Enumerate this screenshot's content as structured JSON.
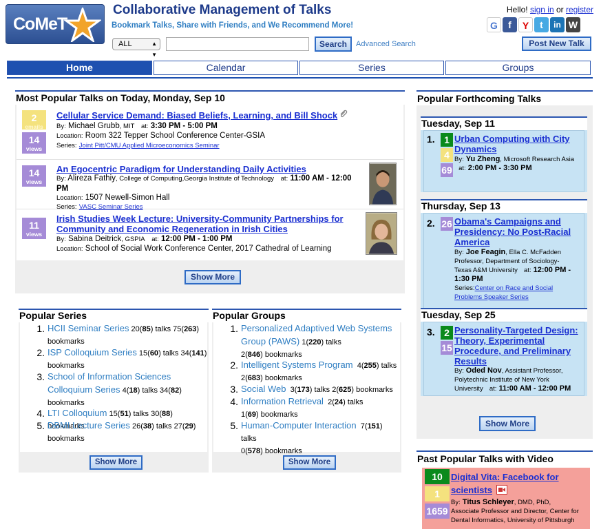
{
  "header": {
    "logo_text": "CoMeT",
    "title": "Collaborative Management of Talks",
    "tagline": "Bookmark Talks, Share with Friends, and We Recommend More!",
    "scope_selected": "ALL",
    "search_value": "",
    "search_button": "Search",
    "advanced_search": "Advanced Search",
    "hello_prefix": "Hello!",
    "sign_in": "sign in",
    "or": "or",
    "register": "register",
    "post_talk": "Post New Talk",
    "social_icons": [
      "google-icon",
      "facebook-icon",
      "yahoo-icon",
      "twitter-icon",
      "linkedin-icon",
      "wordpress-icon"
    ]
  },
  "nav": {
    "tabs": [
      "Home",
      "Calendar",
      "Series",
      "Groups"
    ],
    "active": "Home"
  },
  "popular_today": {
    "heading": "Most Popular Talks on Today, Monday, Sep 10",
    "talks": [
      {
        "title": "Cellular Service Demand: Biased Beliefs, Learning, and Bill Shock",
        "emails": "2",
        "emails_label": "emails",
        "views": "14",
        "views_label": "views",
        "by_label": "By:",
        "speaker": "Michael Grubb",
        "affiliation": ", MIT",
        "at_label": "at:",
        "time": "3:30 PM - 5:00 PM",
        "location_label": "Location:",
        "location": "Room 322 Tepper School Conference Center-GSIA",
        "series_label": "Series:",
        "series": "Joint Pitt/CMU Applied Microeconomics Seminar"
      },
      {
        "title": "An Egocentric Paradigm for Understanding Daily Activities",
        "views": "14",
        "views_label": "views",
        "by_label": "By:",
        "speaker": "Alireza Fathiy",
        "affiliation": ", College of Computing,Georgia Institute of Technology",
        "at_label": "at:",
        "time_a": "11:00 AM -",
        "time_b": "12:00 PM",
        "location_label": "Location:",
        "location": "1507 Newell-Simon Hall",
        "series_label": "Series:",
        "series": "VASC Seminar Series"
      },
      {
        "title_a": "Irish Studies Week Lecture: University-Community Partnerships for",
        "title_b": "Community and Economic Regeneration in Irish Cities",
        "views": "11",
        "views_label": "views",
        "by_label": "By:",
        "speaker": "Sabina Deitrick",
        "affiliation": ", GSPIA",
        "at_label": "at:",
        "time": "12:00 PM - 1:00 PM",
        "location_label": "Location:",
        "location": "School of Social Work Conference Center, 2017 Cathedral of Learning"
      }
    ],
    "show_more": "Show More"
  },
  "popular_series": {
    "heading": "Popular Series",
    "items": [
      {
        "rank": "1.",
        "name": "HCII Seminar Series",
        "a": "20",
        "b": "85",
        "c": "75",
        "d": "263"
      },
      {
        "rank": "2.",
        "name": "ISP Colloquium Series",
        "a": "15",
        "b": "60",
        "c": "34",
        "d": "141"
      },
      {
        "rank": "3.",
        "name_a": "School of Information Sciences",
        "name_b": "Colloquium Series",
        "a": "4",
        "b": "18",
        "c": "34",
        "d": "82"
      },
      {
        "rank": "4.",
        "name": "LTI Colloquium",
        "a": "15",
        "b": "51",
        "c": "30",
        "d": "88"
      },
      {
        "rank": "5.",
        "name": "DBMI Lecture Series",
        "a": "26",
        "b": "38",
        "c": "27",
        "d": "29"
      }
    ],
    "talks_word": "talks",
    "bookmarks_word": "bookmarks",
    "show_more": "Show More"
  },
  "popular_groups": {
    "heading": "Popular Groups",
    "items": [
      {
        "rank": "1.",
        "name_a": "Personalized Adaptived Web Systems",
        "name_b": "Group (PAWS)",
        "a": "1",
        "b": "220",
        "c": "2",
        "d": "846"
      },
      {
        "rank": "2.",
        "name": "Intelligent Systems Program",
        "a": "4",
        "b": "255",
        "c": "2",
        "d": "683"
      },
      {
        "rank": "3.",
        "name": "Social Web",
        "a": "3",
        "b": "173",
        "c": "2",
        "d": "625"
      },
      {
        "rank": "4.",
        "name": "Information Retrieval",
        "a": "2",
        "b": "24",
        "c": "1",
        "d": "69"
      },
      {
        "rank": "5.",
        "name": "Human-Computer Interaction",
        "a": "7",
        "b": "151",
        "c": "0",
        "d": "578"
      }
    ],
    "talks_word": "talks",
    "bookmarks_word": "bookmarks",
    "show_more": "Show More"
  },
  "forthcoming": {
    "heading": "Popular Forthcoming Talks",
    "days": [
      {
        "date": "Tuesday, Sep 11",
        "rank": "1.",
        "n1": "1",
        "n2": "4",
        "n3": "69",
        "title_a": "Urban Computing with City",
        "title_b": "Dynamics",
        "by_label": "By:",
        "speaker": "Yu Zheng",
        "affiliation": ", Microsoft Research Asia",
        "at_label": "at:",
        "time": "2:00 PM - 3:30 PM"
      },
      {
        "date": "Thursday, Sep 13",
        "rank": "2.",
        "n1": "26",
        "title_a": "Obama's Campaigns and",
        "title_b": "Presidency: No Post-Racial",
        "title_c": "America",
        "by_label": "By:",
        "speaker": "Joe Feagin",
        "aff_a": ", Ella C. McFadden",
        "aff_b": "Professor, Department of Sociology-",
        "aff_c": "Texas A&M University",
        "at_label": "at:",
        "time_a": "12:00 PM -",
        "time_b": "1:30 PM",
        "series_label": "Series:",
        "series_a": "Center on Race and Social",
        "series_b": "Problems Speaker Series"
      },
      {
        "date": "Tuesday, Sep 25",
        "rank": "3.",
        "n1": "2",
        "n2": "15",
        "title_a": "Personality-Targeted Design:",
        "title_b": "Theory, Experimental",
        "title_c": "Procedure, and Preliminary",
        "title_d": "Results",
        "by_label": "By:",
        "speaker": "Oded Nov",
        "aff_a": ", Assistant Professor,",
        "aff_b": "Polytechnic Institute of New York",
        "aff_c": "University",
        "at_label": "at:",
        "time": "11:00 AM - 12:00 PM"
      }
    ],
    "show_more": "Show More"
  },
  "past_video": {
    "heading": "Past Popular Talks with Video",
    "n1": "10",
    "n2": "1",
    "n3": "1659",
    "title_a": "Digital Vita: Facebook for",
    "title_b": "scientists",
    "by_label": "By:",
    "speaker": "Titus Schleyer",
    "aff_a": ", DMD, PhD,",
    "aff_b": "Associate Professor and Director, Center for",
    "aff_c": "Dental Informatics, University of Pittsburgh"
  },
  "colors": {
    "brand_blue": "#1e50b0",
    "link": "#1a2fd1",
    "email_badge": "#f4e27e",
    "view_badge": "#a58bd7",
    "bookmark_badge": "#0a8a1c",
    "forthcoming_bg": "#c7e3f4",
    "video_bg": "#f4a09a"
  }
}
